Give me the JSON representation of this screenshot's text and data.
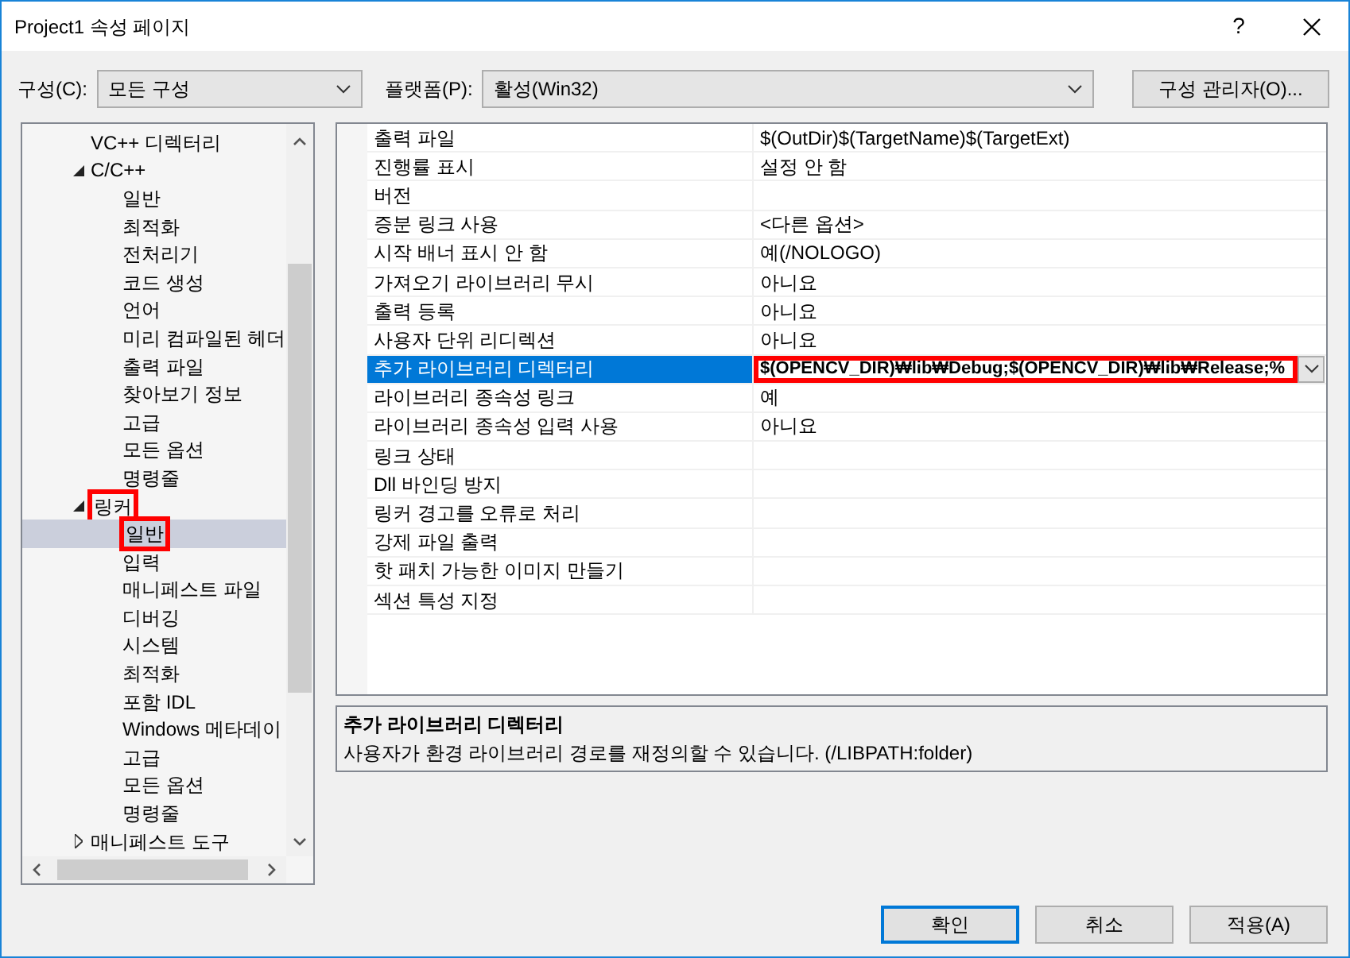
{
  "window": {
    "title": "Project1 속성 페이지",
    "help": "?"
  },
  "toolbar": {
    "configuration": {
      "label": "구성(C):",
      "value": "모든 구성"
    },
    "platform": {
      "label": "플랫폼(P):",
      "value": "활성(Win32)"
    },
    "manager_button": "구성 관리자(O)..."
  },
  "tree": [
    {
      "label": "VC++ 디렉터리",
      "selected": false,
      "annotated": false
    },
    {
      "label": "C/C++",
      "expanded": true,
      "selected": false,
      "annotated": false,
      "children": [
        {
          "label": "일반",
          "selected": false,
          "annotated": false
        },
        {
          "label": "최적화",
          "selected": false,
          "annotated": false
        },
        {
          "label": "전처리기",
          "selected": false,
          "annotated": false
        },
        {
          "label": "코드 생성",
          "selected": false,
          "annotated": false
        },
        {
          "label": "언어",
          "selected": false,
          "annotated": false
        },
        {
          "label": "미리 컴파일된 헤더",
          "selected": false,
          "annotated": false
        },
        {
          "label": "출력 파일",
          "selected": false,
          "annotated": false
        },
        {
          "label": "찾아보기 정보",
          "selected": false,
          "annotated": false
        },
        {
          "label": "고급",
          "selected": false,
          "annotated": false
        },
        {
          "label": "모든 옵션",
          "selected": false,
          "annotated": false
        },
        {
          "label": "명령줄",
          "selected": false,
          "annotated": false
        }
      ]
    },
    {
      "label": "링커",
      "expanded": true,
      "selected": false,
      "annotated": true,
      "children": [
        {
          "label": "일반",
          "selected": true,
          "annotated": true
        },
        {
          "label": "입력",
          "selected": false,
          "annotated": false
        },
        {
          "label": "매니페스트 파일",
          "selected": false,
          "annotated": false
        },
        {
          "label": "디버깅",
          "selected": false,
          "annotated": false
        },
        {
          "label": "시스템",
          "selected": false,
          "annotated": false
        },
        {
          "label": "최적화",
          "selected": false,
          "annotated": false
        },
        {
          "label": "포함 IDL",
          "selected": false,
          "annotated": false
        },
        {
          "label": "Windows 메타데이",
          "selected": false,
          "annotated": false
        },
        {
          "label": "고급",
          "selected": false,
          "annotated": false
        },
        {
          "label": "모든 옵션",
          "selected": false,
          "annotated": false
        },
        {
          "label": "명령줄",
          "selected": false,
          "annotated": false
        }
      ]
    },
    {
      "label": "매니페스트 도구",
      "expanded": false,
      "selected": false,
      "annotated": false
    }
  ],
  "properties": [
    {
      "name": "출력 파일",
      "value": "$(OutDir)$(TargetName)$(TargetExt)",
      "selected": false
    },
    {
      "name": "진행률 표시",
      "value": "설정 안 함",
      "selected": false
    },
    {
      "name": "버전",
      "selected": false
    },
    {
      "name": "증분 링크 사용",
      "value": "<다른 옵션>",
      "selected": false
    },
    {
      "name": "시작 배너 표시 안 함",
      "value": "예(/NOLOGO)",
      "selected": false
    },
    {
      "name": "가져오기 라이브러리 무시",
      "value": "아니요",
      "selected": false
    },
    {
      "name": "출력 등록",
      "value": "아니요",
      "selected": false
    },
    {
      "name": "사용자 단위 리디렉션",
      "value": "아니요",
      "selected": false
    },
    {
      "name": "추가 라이브러리 디렉터리",
      "value": "$(OPENCV_DIR)₩lib₩Debug;$(OPENCV_DIR)₩lib₩Release;%",
      "selected": true,
      "annotated": true
    },
    {
      "name": "라이브러리 종속성 링크",
      "value": "예",
      "selected": false
    },
    {
      "name": "라이브러리 종속성 입력 사용",
      "value": "아니요",
      "selected": false
    },
    {
      "name": "링크 상태",
      "selected": false
    },
    {
      "name": "Dll 바인딩 방지",
      "selected": false
    },
    {
      "name": "링커 경고를 오류로 처리",
      "selected": false
    },
    {
      "name": "강제 파일 출력",
      "selected": false
    },
    {
      "name": "핫 패치 가능한 이미지 만들기",
      "selected": false
    },
    {
      "name": "섹션 특성 지정",
      "selected": false
    }
  ],
  "description": {
    "title": "추가 라이브러리 디렉터리",
    "text": "사용자가 환경 라이브러리 경로를 재정의할 수 있습니다. (/LIBPATH:folder)"
  },
  "buttons": [
    {
      "label": "확인",
      "default": true
    },
    {
      "label": "취소",
      "default": false
    },
    {
      "label": "적용(A)",
      "default": false
    }
  ]
}
